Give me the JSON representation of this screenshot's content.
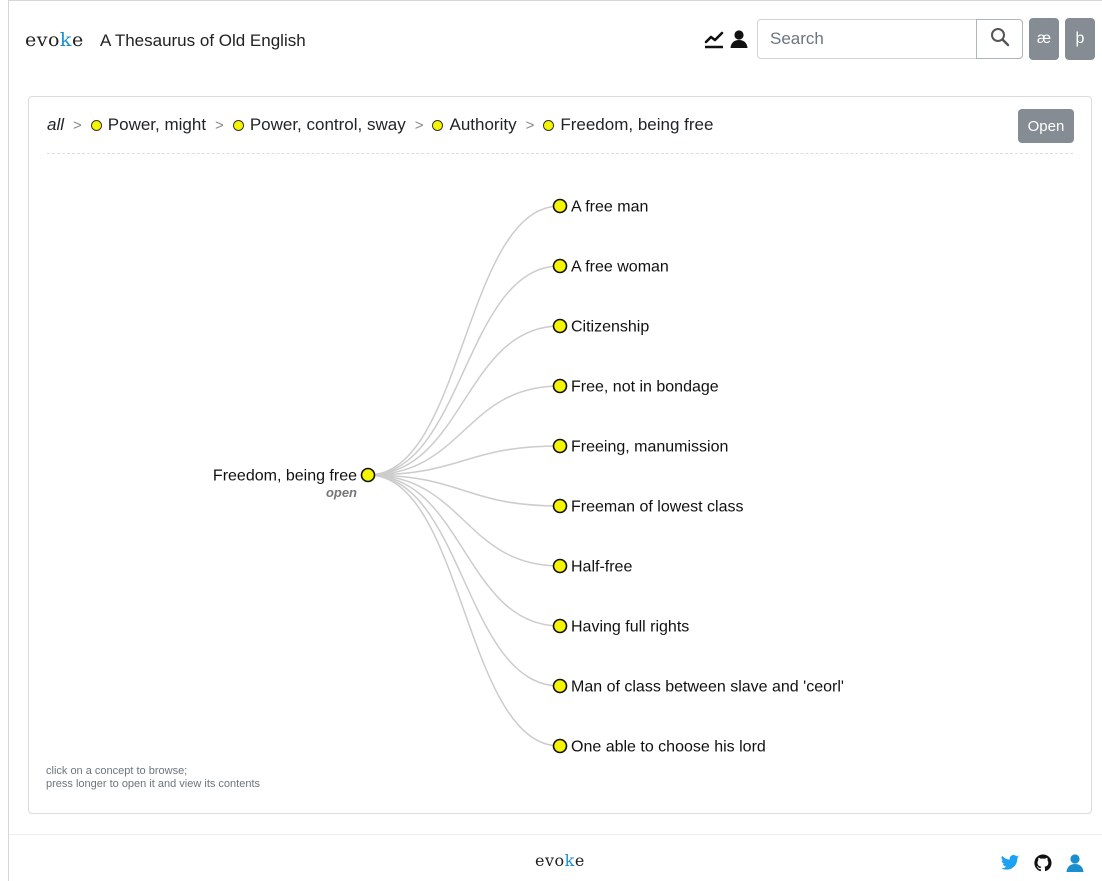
{
  "navbar": {
    "brand_before": "evo",
    "brand_k": "k",
    "brand_after": "e",
    "title": "A Thesaurus of Old English",
    "icons": [
      "chart-line-icon",
      "user-icon",
      "search-icon"
    ],
    "search": {
      "placeholder": "Search",
      "value": ""
    },
    "char_buttons": [
      "æ",
      "þ"
    ]
  },
  "breadcrumb": {
    "root": "all",
    "items": [
      "Power, might",
      "Power, control, sway",
      "Authority",
      "Freedom, being free"
    ],
    "open_label": "Open"
  },
  "tree": {
    "root_label": "Freedom, being free",
    "root_sublabel": "open",
    "children": [
      "A free man",
      "A free woman",
      "Citizenship",
      "Free, not in bondage",
      "Freeing, manumission",
      "Freeman of lowest class",
      "Half-free",
      "Having full rights",
      "Man of class between slave and 'ceorl'",
      "One able to choose his lord"
    ]
  },
  "hint": {
    "line1": "click on a concept to browse;",
    "line2": "press longer to open it and view its contents"
  },
  "footer": {
    "brand_before": "evo",
    "brand_k": "k",
    "brand_after": "e",
    "icons": [
      "twitter-icon",
      "github-icon",
      "user-icon"
    ]
  },
  "colors": {
    "node_fill": "#f5f500",
    "button_bg": "#858c93",
    "link_line": "#cccccc",
    "accent_blue": "#1a8fd0"
  }
}
